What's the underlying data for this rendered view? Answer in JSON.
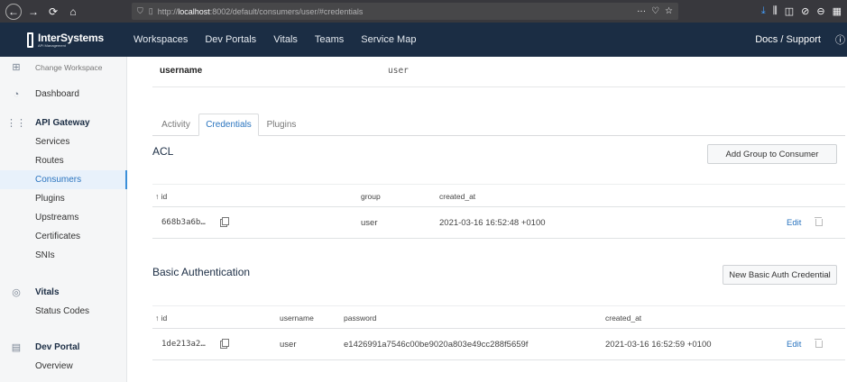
{
  "browser": {
    "url_prefix": "http://",
    "url_host": "localhost",
    "url_rest": ":8002/default/consumers/user/#credentials"
  },
  "header": {
    "logo_name": "InterSystems",
    "logo_sub": "API Management",
    "nav": [
      "Workspaces",
      "Dev Portals",
      "Vitals",
      "Teams",
      "Service Map"
    ],
    "docs_support": "Docs / Support"
  },
  "sidebar": {
    "change_workspace": "Change Workspace",
    "dashboard": "Dashboard",
    "api_gateway": "API Gateway",
    "gateway_items": [
      "Services",
      "Routes",
      "Consumers",
      "Plugins",
      "Upstreams",
      "Certificates",
      "SNIs"
    ],
    "vitals": "Vitals",
    "vitals_items": [
      "Status Codes"
    ],
    "dev_portal": "Dev Portal",
    "dev_portal_items": [
      "Overview"
    ]
  },
  "details": {
    "username_key": "username",
    "username_value": "user"
  },
  "tabs": [
    "Activity",
    "Credentials",
    "Plugins"
  ],
  "acl": {
    "title": "ACL",
    "add_button": "Add Group to Consumer",
    "columns": [
      "↑ id",
      "group",
      "created_at"
    ],
    "rows": [
      {
        "id": "668b3a6b…",
        "group": "user",
        "created_at": "2021-03-16 16:52:48 +0100",
        "edit": "Edit"
      }
    ]
  },
  "basic_auth": {
    "title": "Basic Authentication",
    "add_button": "New Basic Auth Credential",
    "columns": [
      "↑ id",
      "username",
      "password",
      "created_at"
    ],
    "rows": [
      {
        "id": "1de213a2…",
        "username": "user",
        "password": "e1426991a7546c00be9020a803e49cc288f5659f",
        "created_at": "2021-03-16 16:52:59 +0100",
        "edit": "Edit"
      }
    ]
  }
}
